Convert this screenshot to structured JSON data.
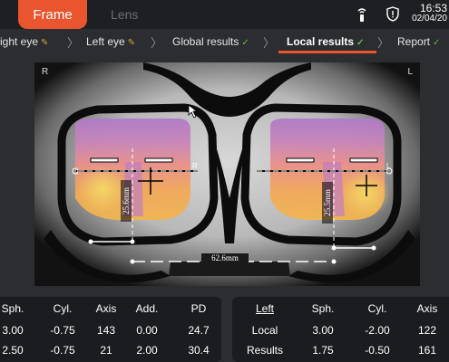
{
  "tabs": {
    "frame": "Frame",
    "lens": "Lens"
  },
  "clock": {
    "time": "16:53",
    "date": "02/04/20"
  },
  "breadcrumb": [
    {
      "label": "ight eye",
      "status": "pen"
    },
    {
      "label": "Left eye",
      "status": "pen"
    },
    {
      "label": "Global results",
      "status": "check"
    },
    {
      "label": "Local results",
      "status": "check"
    },
    {
      "label": "Report",
      "status": "check"
    }
  ],
  "viewer": {
    "corner_left": "R",
    "corner_right": "L",
    "height_right": "25.6mm",
    "height_left": "25.5mm",
    "pd_total": "62.6mm",
    "lens_label_r": "R",
    "lens_label_l": "L"
  },
  "left_table": {
    "headers": [
      "Sph.",
      "Cyl.",
      "Axis",
      "Add.",
      "PD"
    ],
    "rows": [
      [
        "3.00",
        "-0.75",
        "143",
        "0.00",
        "24.7"
      ],
      [
        "2.50",
        "-0.75",
        "21",
        "2.00",
        "30.4"
      ]
    ]
  },
  "right_table": {
    "title": "Left",
    "headers": [
      "Sph.",
      "Cyl.",
      "Axis"
    ],
    "row_labels": [
      "Local",
      "Results"
    ],
    "rows": [
      [
        "3.00",
        "-2.00",
        "122"
      ],
      [
        "1.75",
        "-0.50",
        "161"
      ]
    ]
  }
}
